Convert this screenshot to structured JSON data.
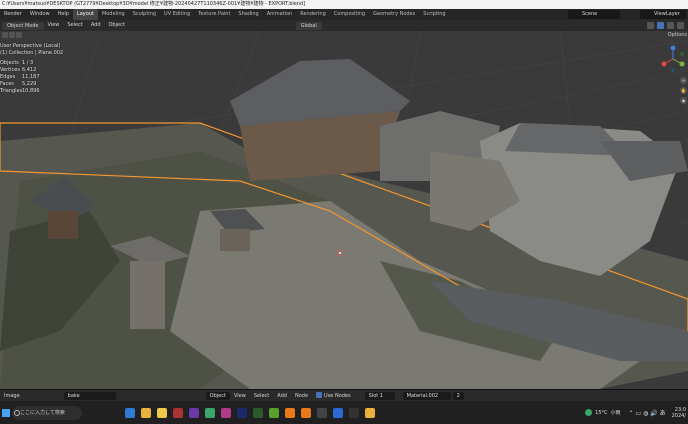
{
  "title_bar": {
    "text": "C:¥Users¥matsuo¥DESKTOP (GT2779¥Desktop¥3D¥model 修正¥建物-20240427T110346Z-001¥建物¥建物 - EXPORT.blend]"
  },
  "menu": {
    "items": [
      "Render",
      "Window",
      "Help"
    ],
    "workspaces": [
      "Layout",
      "Modeling",
      "Sculpting",
      "UV Editing",
      "Texture Paint",
      "Shading",
      "Animation",
      "Rendering",
      "Compositing",
      "Geometry Nodes",
      "Scripting"
    ],
    "active_workspace": "Layout",
    "scene": "Scene",
    "view_layer": "ViewLayer"
  },
  "viewport_header": {
    "mode": "Object Mode",
    "items": [
      "View",
      "Select",
      "Add",
      "Object"
    ],
    "transform": "Global",
    "options": "Options"
  },
  "overlay": {
    "view_name": "User Perspective (Local)",
    "collection": "(1) Collection | Plane.002",
    "stats": [
      {
        "key": "Objects",
        "value": "1 / 3"
      },
      {
        "key": "Vertices",
        "value": "6,412"
      },
      {
        "key": "Edges",
        "value": "11,187"
      },
      {
        "key": "Faces",
        "value": "5,229"
      },
      {
        "key": "Triangles",
        "value": "10,896"
      }
    ]
  },
  "node_header": {
    "editor": "Image",
    "image_name": "bake",
    "object": "Object",
    "items": [
      "View",
      "Select",
      "Add",
      "Node"
    ],
    "use_nodes": "Use Nodes",
    "slot": "Slot 1",
    "material": "Material.002",
    "users": "2"
  },
  "taskbar": {
    "search_placeholder": "ここに入力して検索",
    "weather": "15°C",
    "weather_desc": "小雨",
    "time": "23:0",
    "date": "2024/"
  },
  "colors": {
    "selection_outline": "#f5972e",
    "active_tab": "#464646",
    "gizmo_x": "#e0484b",
    "gizmo_y": "#7cb342",
    "gizmo_z": "#3d7fd9"
  }
}
